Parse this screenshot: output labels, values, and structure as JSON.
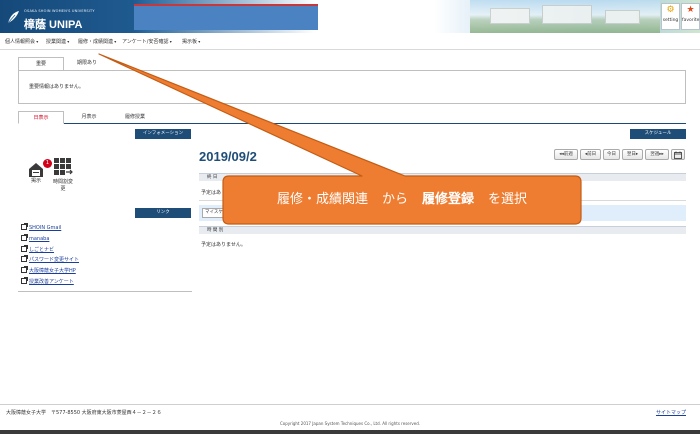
{
  "header": {
    "university_en": "OSAKA SHOIN WOMEN'S UNIVERSITY",
    "app_name": "樟蔭 UNIPA",
    "setting_label": "setting",
    "favorite_label": "favorite"
  },
  "menu": [
    "個人情報照会",
    "授業関連",
    "履修・成績関連",
    "アンケート/安否確認",
    "掲示板"
  ],
  "important": {
    "tabs": [
      "重要",
      "期限あり"
    ],
    "message": "重要情報はありません。"
  },
  "view_tabs": [
    "日表示",
    "月表示",
    "履修授業"
  ],
  "information": {
    "title": "インフォメーション",
    "items": [
      {
        "label": "掲示",
        "icon": "bulletin-icon",
        "badge": "1"
      },
      {
        "label": "時間割変更",
        "icon": "timetable-change-icon"
      }
    ]
  },
  "links": {
    "title": "リンク",
    "items": [
      "SHOIN Gmail",
      "manaba",
      "しごとナビ",
      "パスワード変更サイト",
      "大阪樟蔭女子大学HP",
      "授業改善アンケート"
    ]
  },
  "schedule": {
    "title": "スケジュール",
    "date": "2019/09/2",
    "nav": [
      "◂◂前週",
      "◂前日",
      "今日",
      "翌日▸",
      "翌週▸▸"
    ],
    "section_all_day": "終 日",
    "no_plans_1": "予定はあ",
    "mycal_input": "マイスケ",
    "section_timed": "時 間 別",
    "no_plans_2": "予定はありません。"
  },
  "callout": {
    "part1": "履修・成績関連",
    "part2": "から",
    "part3": "履修登録",
    "part4": "を選択",
    "colors": {
      "fill": "#ee7d31",
      "border": "#c35d15"
    }
  },
  "footer": {
    "address": "大阪樟蔭女子大学　〒577-8550 大阪府東大阪市菱屋西４－２－２６",
    "sitemap": "サイトマップ",
    "copyright": "Copyright 2017 Japan System Techniques Co., Ltd. All rights reserved."
  }
}
